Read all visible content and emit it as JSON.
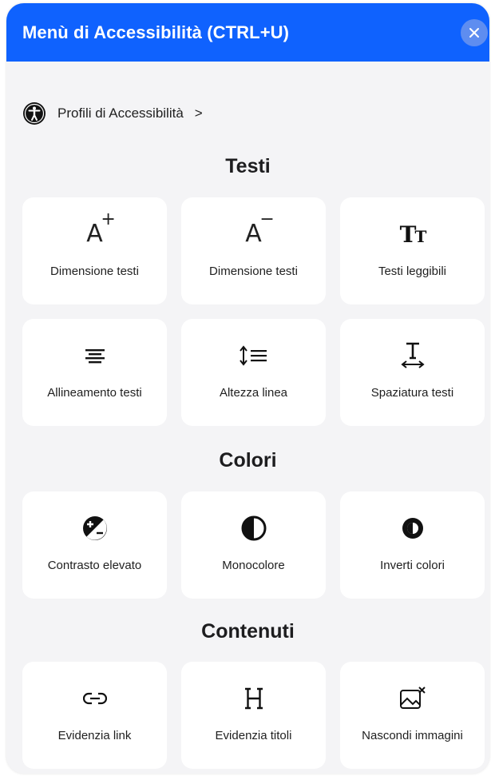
{
  "header": {
    "title": "Menù di Accessibilità (CTRL+U)",
    "close_icon": "close-icon"
  },
  "profiles": {
    "label": "Profili di Accessibilità",
    "chevron": ">"
  },
  "sections": [
    {
      "title": "Testi",
      "items": [
        {
          "label": "Dimensione testi",
          "icon": "text-size-increase-icon"
        },
        {
          "label": "Dimensione testi",
          "icon": "text-size-decrease-icon"
        },
        {
          "label": "Testi leggibili",
          "icon": "readable-font-icon"
        },
        {
          "label": "Allineamento testi",
          "icon": "text-align-icon"
        },
        {
          "label": "Altezza linea",
          "icon": "line-height-icon"
        },
        {
          "label": "Spaziatura testi",
          "icon": "letter-spacing-icon"
        }
      ]
    },
    {
      "title": "Colori",
      "items": [
        {
          "label": "Contrasto elevato",
          "icon": "high-contrast-icon"
        },
        {
          "label": "Monocolore",
          "icon": "monochrome-icon"
        },
        {
          "label": "Inverti colori",
          "icon": "invert-colors-icon"
        }
      ]
    },
    {
      "title": "Contenuti",
      "items": [
        {
          "label": "Evidenzia link",
          "icon": "link-icon"
        },
        {
          "label": "Evidenzia titoli",
          "icon": "heading-icon"
        },
        {
          "label": "Nascondi immagini",
          "icon": "hide-images-icon"
        }
      ]
    }
  ],
  "colors": {
    "header": "#0f62fe",
    "panel_background": "#f4f4f6",
    "card_background": "#ffffff",
    "close_button": "#5e8df0"
  }
}
